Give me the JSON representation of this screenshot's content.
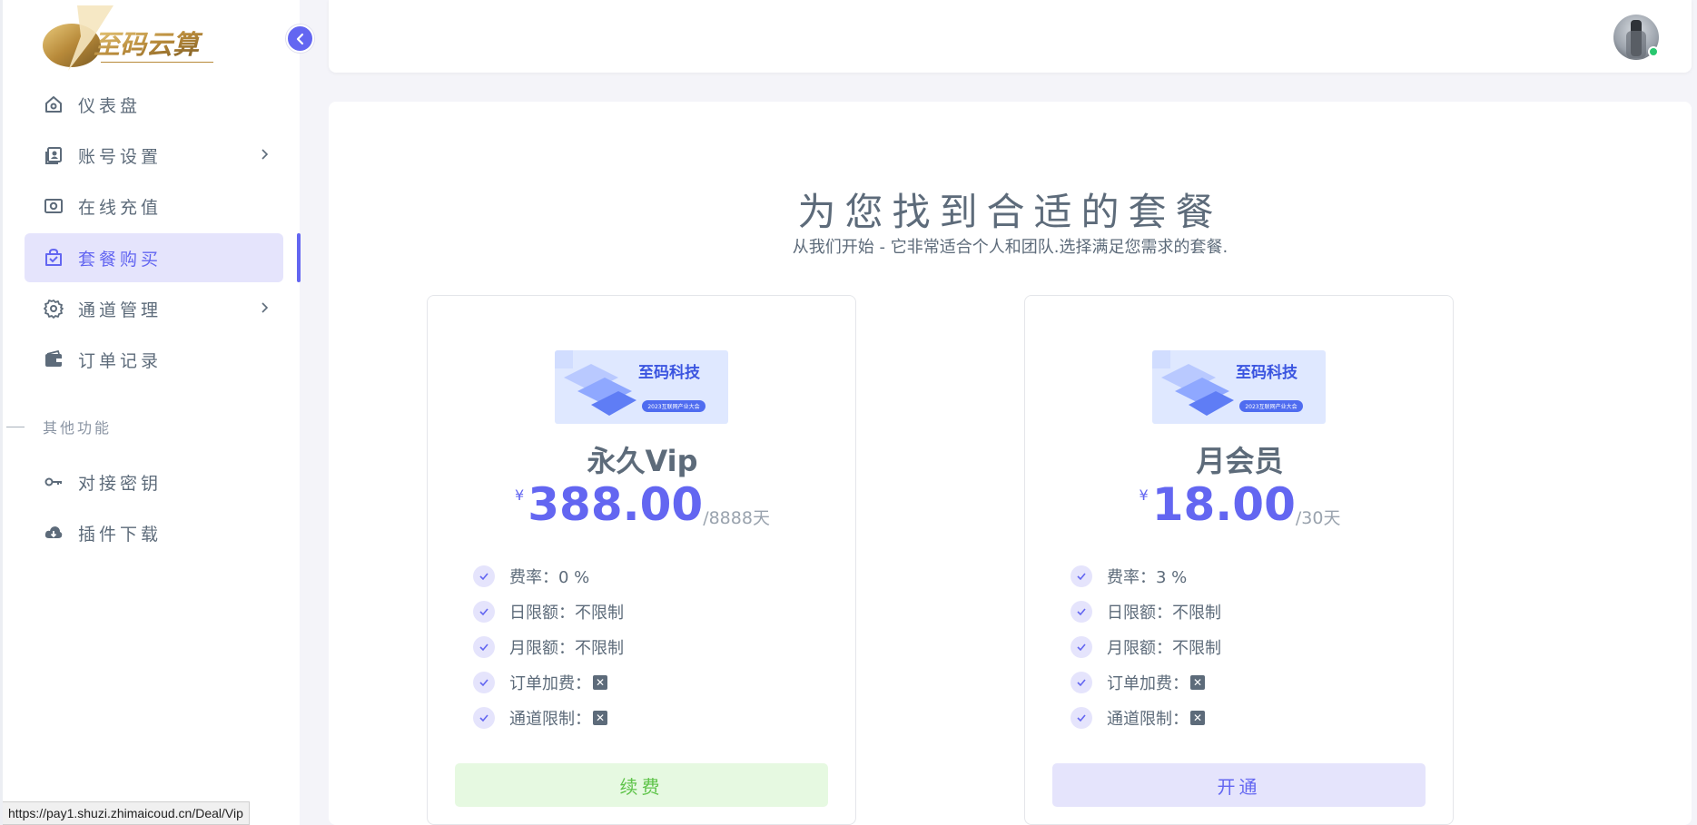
{
  "brand": {
    "logo_text": "至码云算"
  },
  "sidebar": {
    "items": [
      {
        "label": "仪表盘",
        "icon": "home-icon"
      },
      {
        "label": "账号设置",
        "icon": "id-card-icon"
      },
      {
        "label": "在线充值",
        "icon": "cash-icon"
      },
      {
        "label": "套餐购买",
        "icon": "shopping-bag-icon"
      },
      {
        "label": "通道管理",
        "icon": "gear-icon"
      },
      {
        "label": "订单记录",
        "icon": "wallet-icon"
      },
      {
        "label": "对接密钥",
        "icon": "key-icon"
      },
      {
        "label": "插件下载",
        "icon": "cloud-download-icon"
      }
    ],
    "section_title": "其他功能"
  },
  "main": {
    "heading": "为您找到合适的套餐",
    "subheading": "从我们开始 - 它非常适合个人和团队.选择满足您需求的套餐.",
    "plans": [
      {
        "banner_text": "至码科技",
        "banner_subtext": "2023互联网产业大会",
        "name": "永久Vip",
        "currency": "¥",
        "price": "388.00",
        "period": "/8888天",
        "features": [
          "费率：0 %",
          "日限额：不限制",
          "月限额：不限制",
          "订单加费：",
          "通道限制："
        ],
        "button": "续费"
      },
      {
        "banner_text": "至码科技",
        "banner_subtext": "2023互联网产业大会",
        "name": "月会员",
        "currency": "¥",
        "price": "18.00",
        "period": "/30天",
        "features": [
          "费率：3 %",
          "日限额：不限制",
          "月限额：不限制",
          "订单加费：",
          "通道限制："
        ],
        "button": "开通"
      }
    ]
  },
  "status_bar": {
    "url": "https://pay1.shuzi.zhimaicoud.cn/Deal/Vip"
  },
  "colors": {
    "accent": "#6366f1",
    "accent_light": "#e5e4fc",
    "green": "#5fc44a",
    "green_light": "#e6f9e1",
    "text": "#5d6b7a"
  }
}
